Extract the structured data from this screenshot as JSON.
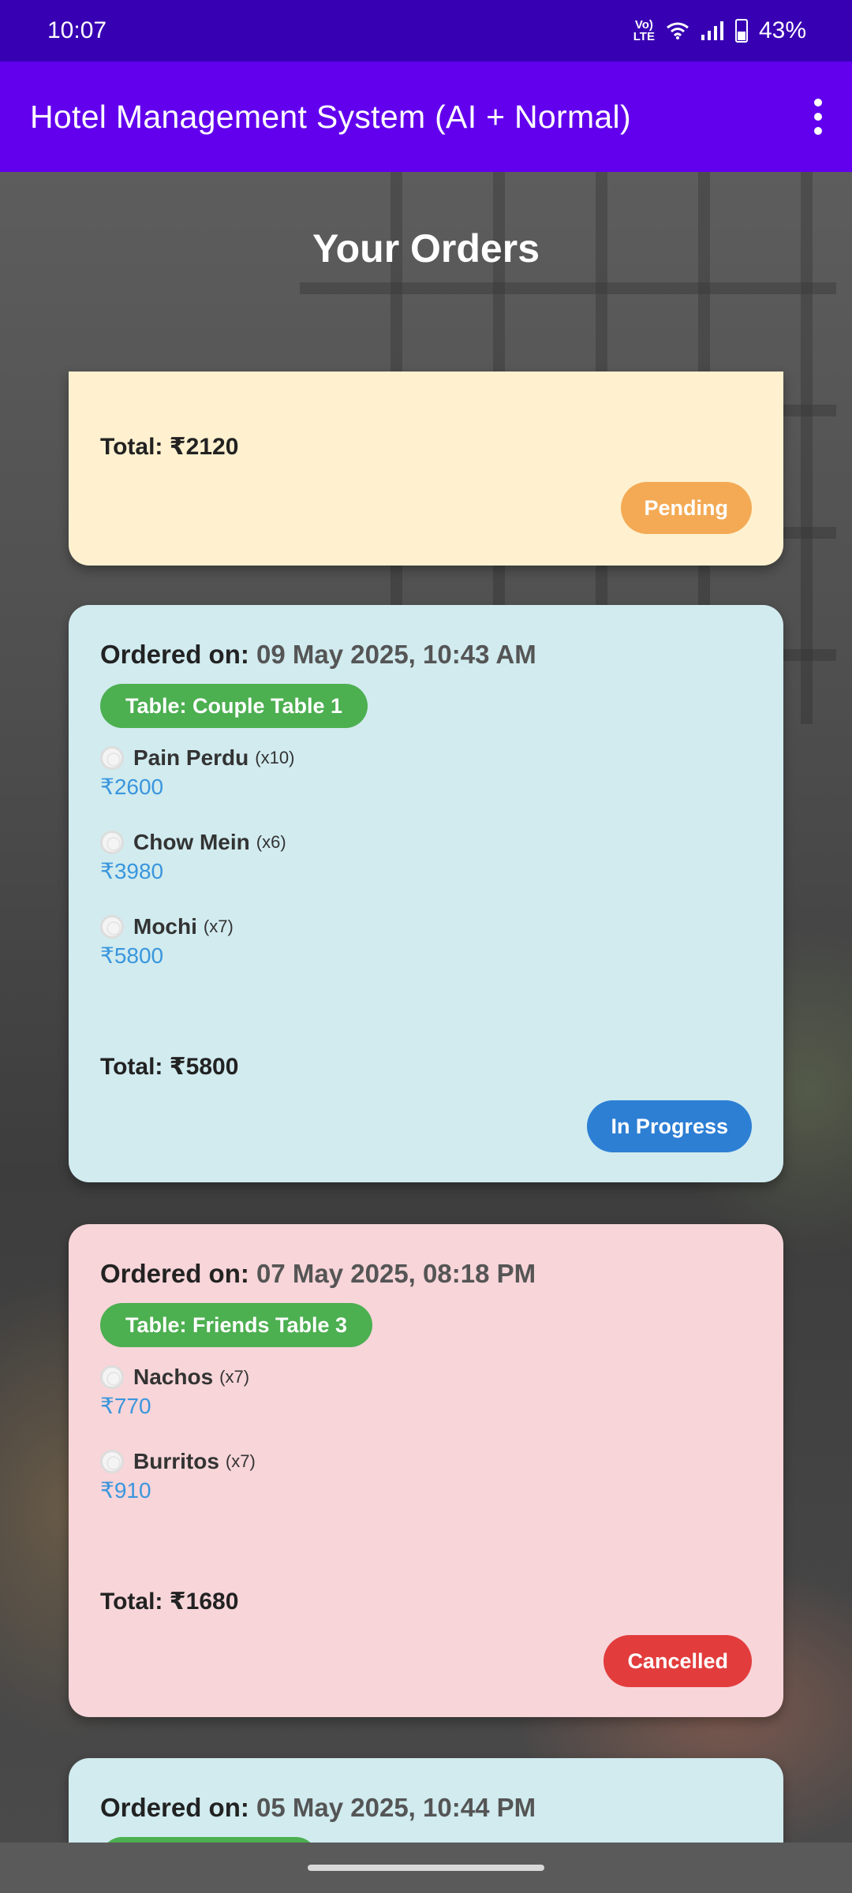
{
  "status_bar": {
    "time": "10:07",
    "network": "Vo) LTE",
    "battery": "43%"
  },
  "app_bar": {
    "title": "Hotel Management System (AI + Normal)",
    "menu_icon": "more-vert-icon"
  },
  "page": {
    "title": "Your Orders"
  },
  "orders": [
    {
      "total_label": "Total:",
      "total_value": "₹2120",
      "status": "Pending",
      "status_color": "#f4aa55",
      "card_color": "#fff1cf"
    },
    {
      "ordered_label": "Ordered on:",
      "date": "09 May 2025, 10:43 AM",
      "table": "Table: Couple Table 1",
      "items": [
        {
          "name": "Pain Perdu",
          "qty": "(x10)",
          "price": "₹2600"
        },
        {
          "name": "Chow Mein",
          "qty": "(x6)",
          "price": "₹3980"
        },
        {
          "name": "Mochi",
          "qty": "(x7)",
          "price": "₹5800"
        }
      ],
      "total_label": "Total:",
      "total_value": "₹5800",
      "status": "In Progress",
      "status_color": "#2d7fd4",
      "card_color": "#d1ebef"
    },
    {
      "ordered_label": "Ordered on:",
      "date": "07 May 2025, 08:18 PM",
      "table": "Table: Friends Table 3",
      "items": [
        {
          "name": "Nachos",
          "qty": "(x7)",
          "price": "₹770"
        },
        {
          "name": "Burritos",
          "qty": "(x7)",
          "price": "₹910"
        }
      ],
      "total_label": "Total:",
      "total_value": "₹1680",
      "status": "Cancelled",
      "status_color": "#e23c3c",
      "card_color": "#f7d5d9"
    },
    {
      "ordered_label": "Ordered on:",
      "date": "05 May 2025, 10:44 PM",
      "card_color": "#d1ebef"
    }
  ]
}
